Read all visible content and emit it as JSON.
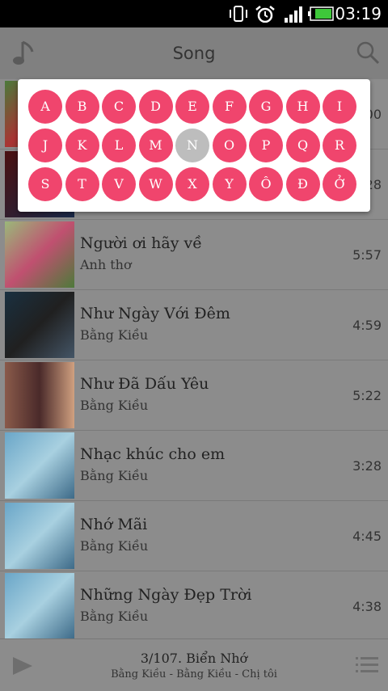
{
  "status": {
    "time": "03:19"
  },
  "header": {
    "title": "Song"
  },
  "partial_durations": [
    "00",
    "28"
  ],
  "alphabet": [
    "A",
    "B",
    "C",
    "D",
    "E",
    "F",
    "G",
    "H",
    "I",
    "J",
    "K",
    "L",
    "M",
    "N",
    "O",
    "P",
    "Q",
    "R",
    "S",
    "T",
    "V",
    "W",
    "X",
    "Y",
    "Ô",
    "Đ",
    "Ở"
  ],
  "selected_letter": "N",
  "songs": [
    {
      "title": "Người ơi hãy về",
      "artist": "Anh thơ",
      "duration": "5:57"
    },
    {
      "title": "Như Ngày Với Đêm",
      "artist": "Bằng Kiều",
      "duration": "4:59"
    },
    {
      "title": "Như Đã Dấu Yêu",
      "artist": "Bằng Kiều",
      "duration": "5:22"
    },
    {
      "title": "Nhạc khúc cho em",
      "artist": "Bằng Kiều",
      "duration": "3:28"
    },
    {
      "title": "Nhớ Mãi",
      "artist": "Bằng Kiều",
      "duration": "4:45"
    },
    {
      "title": "Những Ngày Đẹp Trời",
      "artist": "Bằng Kiều",
      "duration": "4:38"
    }
  ],
  "player": {
    "title": "3/107. Biển Nhớ",
    "subtitle": "Bằng Kiều - Bằng Kiều - Chị tôi"
  }
}
